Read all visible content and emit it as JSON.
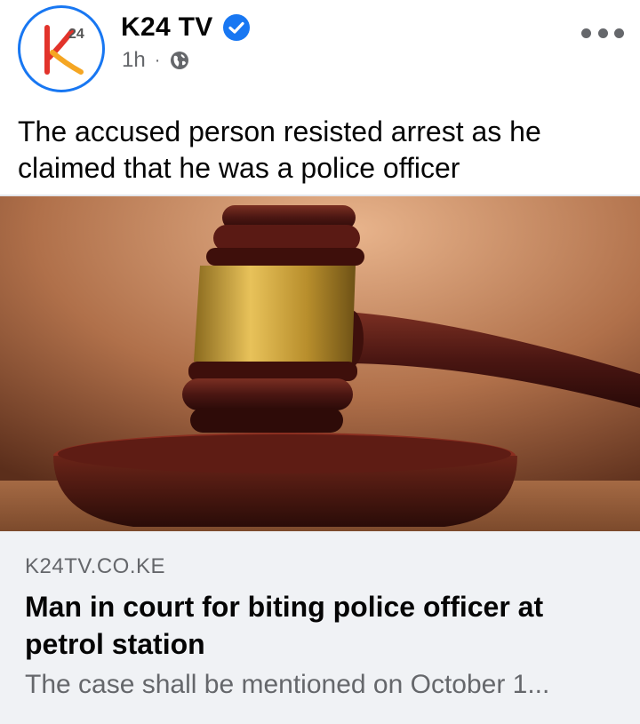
{
  "post": {
    "page_name": "K24 TV",
    "time": "1h",
    "separator": "·",
    "audience_icon": "globe-icon",
    "verified_icon": "verified-badge-icon",
    "more_icon": "more-options-icon",
    "caption": "The accused person resisted arrest as he claimed that he was a police officer"
  },
  "avatar": {
    "logo_text": "24"
  },
  "link_preview": {
    "domain": "K24TV.CO.KE",
    "title": "Man in court for biting police officer at petrol station",
    "description": "The case shall be mentioned on October 1..."
  },
  "colors": {
    "accent": "#1877f2",
    "text": "#050505",
    "secondary_text": "#65676b",
    "card_background": "#f0f2f5"
  }
}
